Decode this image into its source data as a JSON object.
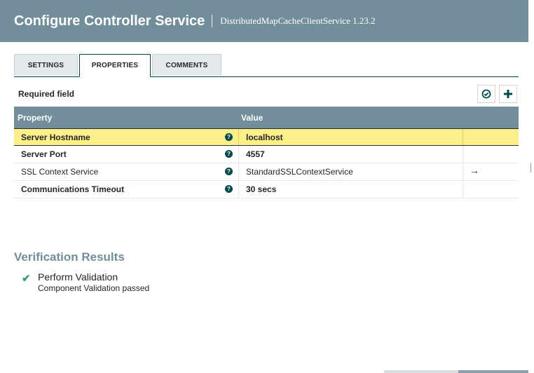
{
  "header": {
    "title": "Configure Controller Service",
    "subtitle": "DistributedMapCacheClientService 1.23.2"
  },
  "tabs": [
    {
      "label": "SETTINGS",
      "active": false
    },
    {
      "label": "PROPERTIES",
      "active": true
    },
    {
      "label": "COMMENTS",
      "active": false
    }
  ],
  "properties_panel": {
    "required_label": "Required field",
    "verify_icon": "check-circle-icon",
    "add_icon": "plus-icon",
    "columns": {
      "property": "Property",
      "value": "Value"
    },
    "rows": [
      {
        "name": "Server Hostname",
        "required": true,
        "value": "localhost",
        "selected": true,
        "help": "?"
      },
      {
        "name": "Server Port",
        "required": true,
        "value": "4557",
        "selected": false,
        "help": "?"
      },
      {
        "name": "SSL Context Service",
        "required": false,
        "value": "StandardSSLContextService",
        "selected": false,
        "help": "?",
        "goto": "→"
      },
      {
        "name": "Communications Timeout",
        "required": true,
        "value": "30 secs",
        "selected": false,
        "help": "?"
      }
    ]
  },
  "verification": {
    "title": "Verification Results",
    "items": [
      {
        "name": "Perform Validation",
        "message": "Component Validation passed",
        "status": "passed",
        "icon": "checkmark-icon"
      }
    ]
  },
  "colors": {
    "header": "#728e9b",
    "accent": "#004849",
    "highlight": "#fcee88",
    "success": "#3d9b6a"
  }
}
